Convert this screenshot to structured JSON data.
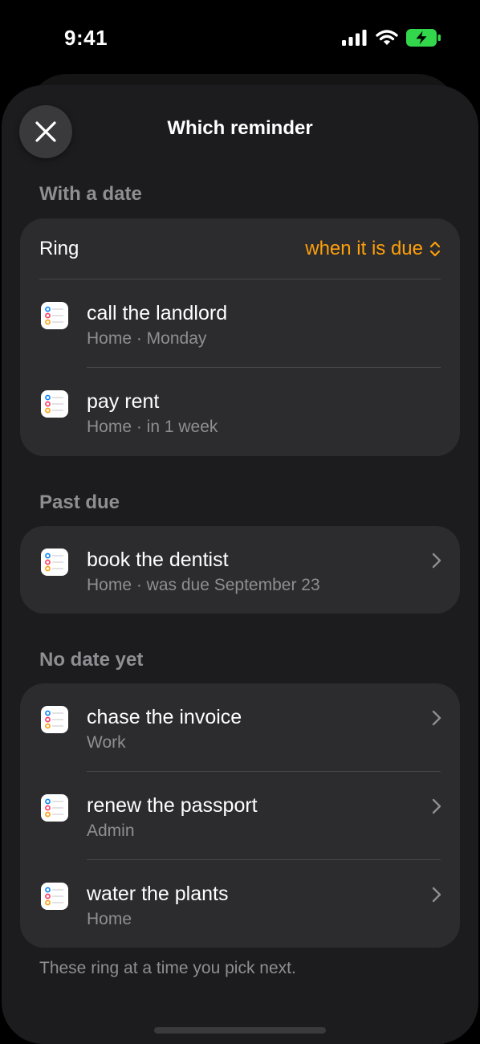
{
  "status": {
    "time": "9:41"
  },
  "header": {
    "title": "Which reminder"
  },
  "sections": {
    "with_date": {
      "header": "With a date",
      "ring_label": "Ring",
      "ring_value": "when it is due",
      "items": [
        {
          "title": "call the landlord",
          "subtitle": "Home · Monday"
        },
        {
          "title": "pay rent",
          "subtitle": "Home · in 1 week"
        }
      ]
    },
    "past_due": {
      "header": "Past due",
      "items": [
        {
          "title": "book the dentist",
          "subtitle": "Home · was due September 23"
        }
      ]
    },
    "no_date": {
      "header": "No date yet",
      "items": [
        {
          "title": "chase the invoice",
          "subtitle": "Work"
        },
        {
          "title": "renew the passport",
          "subtitle": "Admin"
        },
        {
          "title": "water the plants",
          "subtitle": "Home"
        }
      ]
    }
  },
  "footer": {
    "note": "These ring at a time you pick next."
  },
  "colors": {
    "accent": "#ff9f0a",
    "battery": "#32d74b",
    "group_bg": "#2c2c2e",
    "sheet_bg": "#1c1c1e"
  },
  "icons": [
    "close-icon",
    "reminders-app-icon",
    "chevron-right-icon",
    "up-down-chevron-icon",
    "signal-icon",
    "wifi-icon",
    "battery-charging-icon"
  ]
}
